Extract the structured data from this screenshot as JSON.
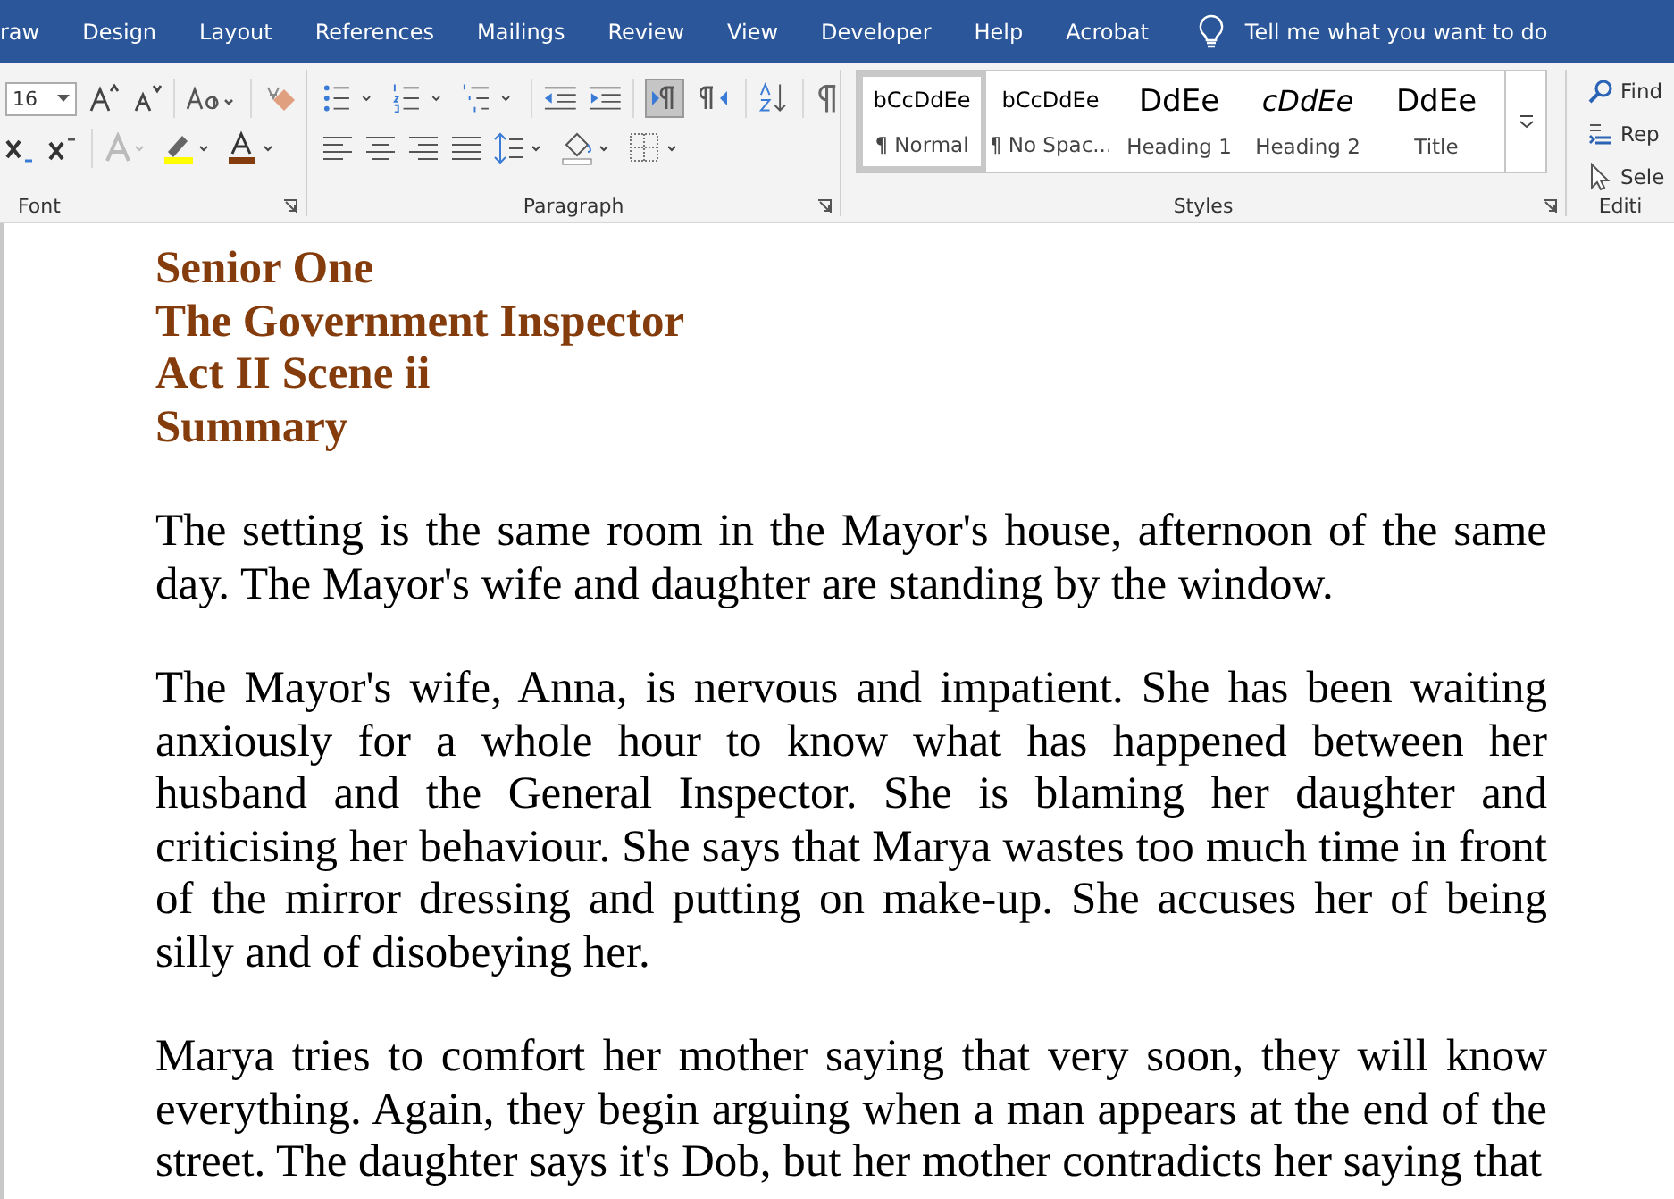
{
  "tabs": [
    {
      "label": "raw"
    },
    {
      "label": "Design"
    },
    {
      "label": "Layout"
    },
    {
      "label": "References"
    },
    {
      "label": "Mailings"
    },
    {
      "label": "Review"
    },
    {
      "label": "View"
    },
    {
      "label": "Developer"
    },
    {
      "label": "Help"
    },
    {
      "label": "Acrobat"
    }
  ],
  "tell_me": {
    "placeholder": "Tell me what you want to do"
  },
  "font_group": {
    "label": "Font",
    "size": "16"
  },
  "paragraph_group": {
    "label": "Paragraph",
    "direction_toggles": [
      {
        "selected": true
      },
      {
        "selected": false
      }
    ]
  },
  "styles_group": {
    "label": "Styles",
    "items": [
      {
        "preview": "bCcDdEe",
        "name": "¶ Normal",
        "kind": "body",
        "selected": true
      },
      {
        "preview": "bCcDdEe",
        "name": "¶ No Spac...",
        "kind": "body",
        "selected": false
      },
      {
        "preview": "DdEe",
        "name": "Heading 1",
        "kind": "heading",
        "selected": false
      },
      {
        "preview": "cDdEe",
        "name": "Heading 2",
        "kind": "italic",
        "selected": false
      },
      {
        "preview": "DdEe",
        "name": "Title",
        "kind": "heading",
        "selected": false
      }
    ]
  },
  "editing_group": {
    "label": "Editi",
    "items": [
      {
        "label": "Find",
        "kind": "find"
      },
      {
        "label": "Rep",
        "kind": "replace"
      },
      {
        "label": "Sele",
        "kind": "select"
      }
    ]
  },
  "document": {
    "headings": [
      "Senior One",
      "The Government Inspector",
      "Act II Scene ii",
      "Summary"
    ],
    "paragraphs": [
      "The setting is the same room in the Mayor's house, afternoon of the same day. The Mayor's wife and daughter are standing by the window.",
      "The Mayor's wife, Anna, is nervous and impatient. She has been waiting anxiously for a whole hour to know what has happened between her husband and the General Inspector. She is blaming her daughter and criticising her behaviour. She says that Marya wastes too much time in front of the mirror dressing and putting on make-up. She accuses her of being silly and of disobeying her.",
      "Marya tries to comfort her mother saying that very soon, they will know everything. Again, they begin arguing when a man appears at the end of the street. The daughter says it's Dob, but her mother contradicts her saying that"
    ]
  }
}
